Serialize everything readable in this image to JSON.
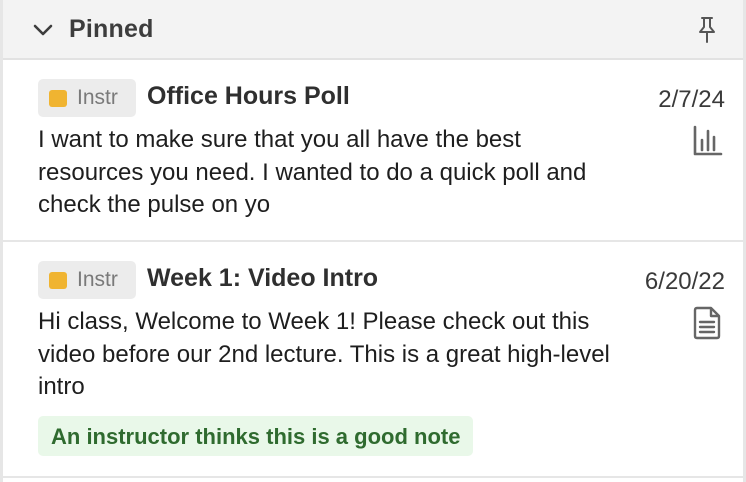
{
  "section": {
    "title": "Pinned"
  },
  "posts": [
    {
      "badge": "Instr",
      "title": "Office Hours Poll",
      "date": "2/7/24",
      "body": "I want to make sure that you all have the best resources you need. I wanted to do a quick poll and check the pulse on yo",
      "type_icon": "poll-icon"
    },
    {
      "badge": "Instr",
      "title": "Week 1: Video Intro",
      "date": "6/20/22",
      "body": "Hi class,  Welcome to Week 1! Please check out this video before our 2nd lecture. This is a great high-level intro",
      "type_icon": "note-icon",
      "endorsement": "An instructor thinks this is a good note"
    }
  ],
  "colors": {
    "badge_square": "#f0b431",
    "endorsement_bg": "#e9f8e9",
    "endorsement_text": "#2f6b2f",
    "header_bg": "#f3f3f3"
  }
}
